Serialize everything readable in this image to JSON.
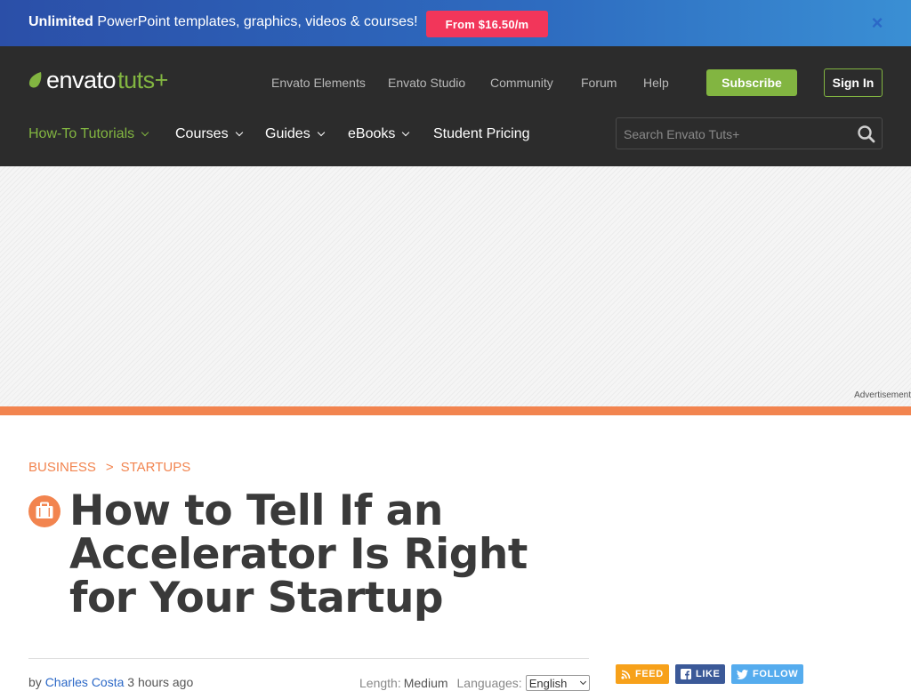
{
  "promo": {
    "bold": "Unlimited",
    "text": " PowerPoint templates, graphics, videos & courses!",
    "button": "From $16.50/m",
    "close_glyph": "×"
  },
  "logo": {
    "word": "envato",
    "tuts": "tuts+"
  },
  "topnav": [
    "Envato Elements",
    "Envato Studio",
    "Community",
    "Forum",
    "Help"
  ],
  "auth": {
    "subscribe": "Subscribe",
    "signin": "Sign In"
  },
  "mainnav": [
    {
      "label": "How-To Tutorials",
      "dropdown": true,
      "active": true
    },
    {
      "label": "Courses",
      "dropdown": true
    },
    {
      "label": "Guides",
      "dropdown": true
    },
    {
      "label": "eBooks",
      "dropdown": true
    },
    {
      "label": "Student Pricing",
      "dropdown": false
    }
  ],
  "search": {
    "placeholder": "Search Envato Tuts+"
  },
  "ad": {
    "label": "Advertisement"
  },
  "article": {
    "crumbs": [
      "BUSINESS",
      "STARTUPS"
    ],
    "crumb_sep": ">",
    "title": "How to Tell If an Accelerator Is Right for Your Startup",
    "by": "by",
    "author": "Charles Costa",
    "time": "3 hours ago",
    "length_label": "Length:",
    "length_value": "Medium",
    "lang_label": "Languages:",
    "lang_value": "English"
  },
  "social": [
    {
      "label": "FEED",
      "color": "#f7a11a",
      "icon": "rss-icon"
    },
    {
      "label": "LIKE",
      "color": "#3b5998",
      "icon": "facebook-icon"
    },
    {
      "label": "FOLLOW",
      "color": "#55acee",
      "icon": "twitter-icon"
    }
  ],
  "colors": {
    "accent_green": "#82b541",
    "accent_orange": "#f2844f",
    "promo_button": "#f2365a",
    "header_bg": "#2c2c2c"
  }
}
